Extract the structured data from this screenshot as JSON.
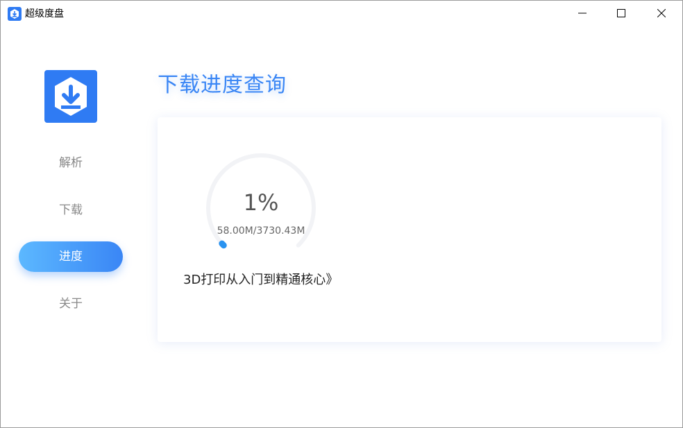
{
  "window": {
    "title": "超级度盘"
  },
  "sidebar": {
    "items": [
      {
        "label": "解析"
      },
      {
        "label": "下载"
      },
      {
        "label": "进度"
      },
      {
        "label": "关于"
      }
    ]
  },
  "main": {
    "title": "下载进度查询",
    "progress": {
      "percent_text": "1%",
      "percent": 1,
      "size_text": "58.00M/3730.43M",
      "file_name": "《3D打印从入门到精通核心"
    }
  },
  "colors": {
    "accent": "#3a86f5",
    "accent_light": "#5cb8ff",
    "logo_bg": "#2f7bf3"
  }
}
